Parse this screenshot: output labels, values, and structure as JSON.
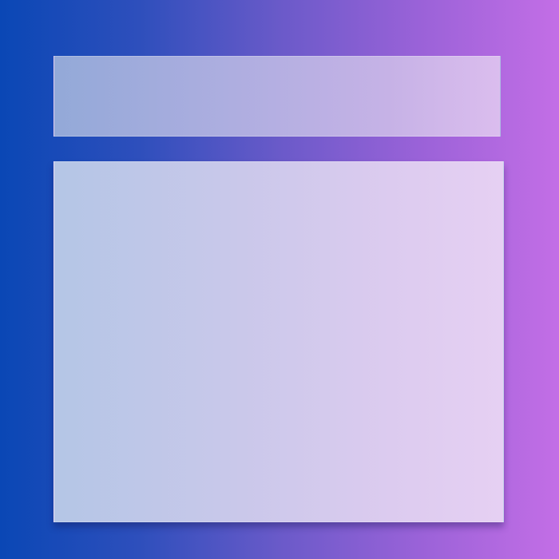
{
  "theme": {
    "background_start": "#0a47b5",
    "background_end": "#c36ee6",
    "panel_tint": "#dcd0f0"
  }
}
